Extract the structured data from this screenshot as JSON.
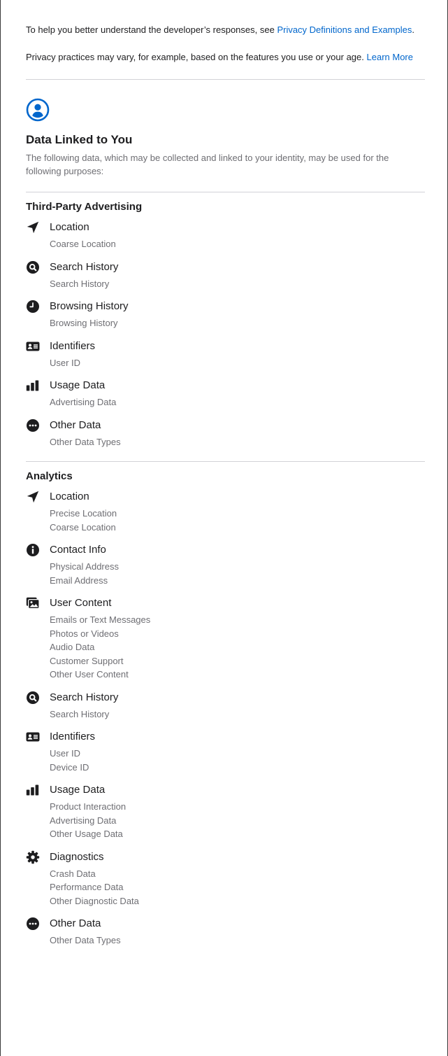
{
  "intro": {
    "line1_prefix": "To help you better understand the developer’s responses, see ",
    "line1_link": "Privacy Definitions and Examples",
    "line1_suffix": ".",
    "line2_text": "Privacy practices may vary, for example, based on the features you use or your age. ",
    "line2_link": "Learn More"
  },
  "section": {
    "icon": "person-circle-icon",
    "title": "Data Linked to You",
    "description": "The following data, which may be collected and linked to your identity, may be used for the following purposes:"
  },
  "groups": [
    {
      "title": "Third-Party Advertising",
      "items": [
        {
          "icon": "location-arrow-icon",
          "title": "Location",
          "subs": [
            "Coarse Location"
          ]
        },
        {
          "icon": "search-icon",
          "title": "Search History",
          "subs": [
            "Search History"
          ]
        },
        {
          "icon": "clock-icon",
          "title": "Browsing History",
          "subs": [
            "Browsing History"
          ]
        },
        {
          "icon": "id-card-icon",
          "title": "Identifiers",
          "subs": [
            "User ID"
          ]
        },
        {
          "icon": "bar-chart-icon",
          "title": "Usage Data",
          "subs": [
            "Advertising Data"
          ]
        },
        {
          "icon": "ellipsis-circle-icon",
          "title": "Other Data",
          "subs": [
            "Other Data Types"
          ]
        }
      ]
    },
    {
      "title": "Analytics",
      "items": [
        {
          "icon": "location-arrow-icon",
          "title": "Location",
          "subs": [
            "Precise Location",
            "Coarse Location"
          ]
        },
        {
          "icon": "info-circle-icon",
          "title": "Contact Info",
          "subs": [
            "Physical Address",
            "Email Address"
          ]
        },
        {
          "icon": "photos-icon",
          "title": "User Content",
          "subs": [
            "Emails or Text Messages",
            "Photos or Videos",
            "Audio Data",
            "Customer Support",
            "Other User Content"
          ]
        },
        {
          "icon": "search-icon",
          "title": "Search History",
          "subs": [
            "Search History"
          ]
        },
        {
          "icon": "id-card-icon",
          "title": "Identifiers",
          "subs": [
            "User ID",
            "Device ID"
          ]
        },
        {
          "icon": "bar-chart-icon",
          "title": "Usage Data",
          "subs": [
            "Product Interaction",
            "Advertising Data",
            "Other Usage Data"
          ]
        },
        {
          "icon": "gear-icon",
          "title": "Diagnostics",
          "subs": [
            "Crash Data",
            "Performance Data",
            "Other Diagnostic Data"
          ]
        },
        {
          "icon": "ellipsis-circle-icon",
          "title": "Other Data",
          "subs": [
            "Other Data Types"
          ]
        }
      ]
    }
  ],
  "colors": {
    "link": "#0066cc",
    "text": "#1d1d1f",
    "secondary": "#6e6e73",
    "divider": "#d2d2d7"
  }
}
